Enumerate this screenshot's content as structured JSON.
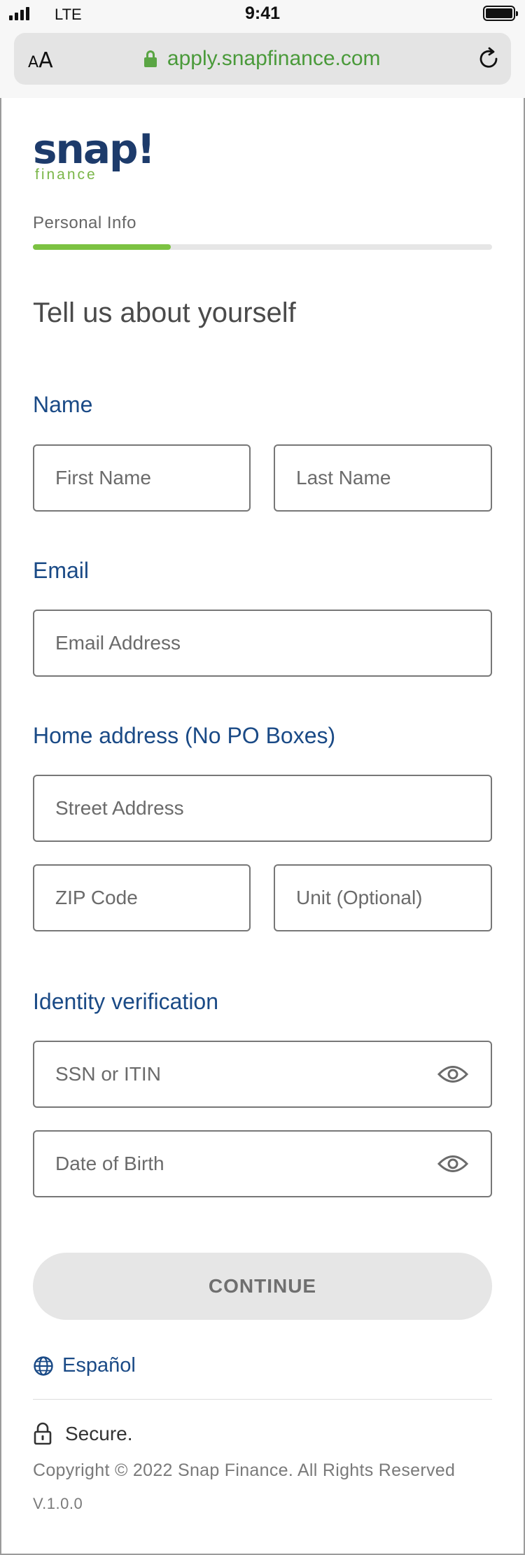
{
  "status_bar": {
    "carrier": "LTE",
    "time": "9:41"
  },
  "browser": {
    "text_size_small": "A",
    "text_size_big": "A",
    "url": "apply.snapfinance.com",
    "lock_color": "#5aa544"
  },
  "logo": {
    "wordmark": "snap!",
    "subtitle": "finance"
  },
  "progress": {
    "step_label": "Personal Info",
    "fraction": 0.3,
    "fill_color": "#7cc242"
  },
  "page": {
    "title": "Tell us about yourself"
  },
  "sections": {
    "name": {
      "label": "Name",
      "first_name_placeholder": "First Name",
      "last_name_placeholder": "Last Name"
    },
    "email": {
      "label": "Email",
      "email_placeholder": "Email Address"
    },
    "address": {
      "label": "Home address (No PO Boxes)",
      "street_placeholder": "Street Address",
      "zip_placeholder": "ZIP Code",
      "unit_placeholder": "Unit (Optional)"
    },
    "identity": {
      "label": "Identity verification",
      "ssn_placeholder": "SSN or ITIN",
      "dob_placeholder": "Date of Birth"
    }
  },
  "actions": {
    "continue_label": "CONTINUE"
  },
  "footer": {
    "language_link": "Español",
    "secure_label": "Secure.",
    "copyright": "Copyright © 2022 Snap Finance. All Rights Reserved",
    "version": "V.1.0.0"
  },
  "colors": {
    "brand_navy": "#1d3b6b",
    "brand_green": "#7ab648",
    "section_blue": "#1a4a86"
  },
  "icons": [
    "signal-icon",
    "battery-icon",
    "lock-icon",
    "reload-icon",
    "eye-icon",
    "globe-icon",
    "padlock-icon"
  ]
}
